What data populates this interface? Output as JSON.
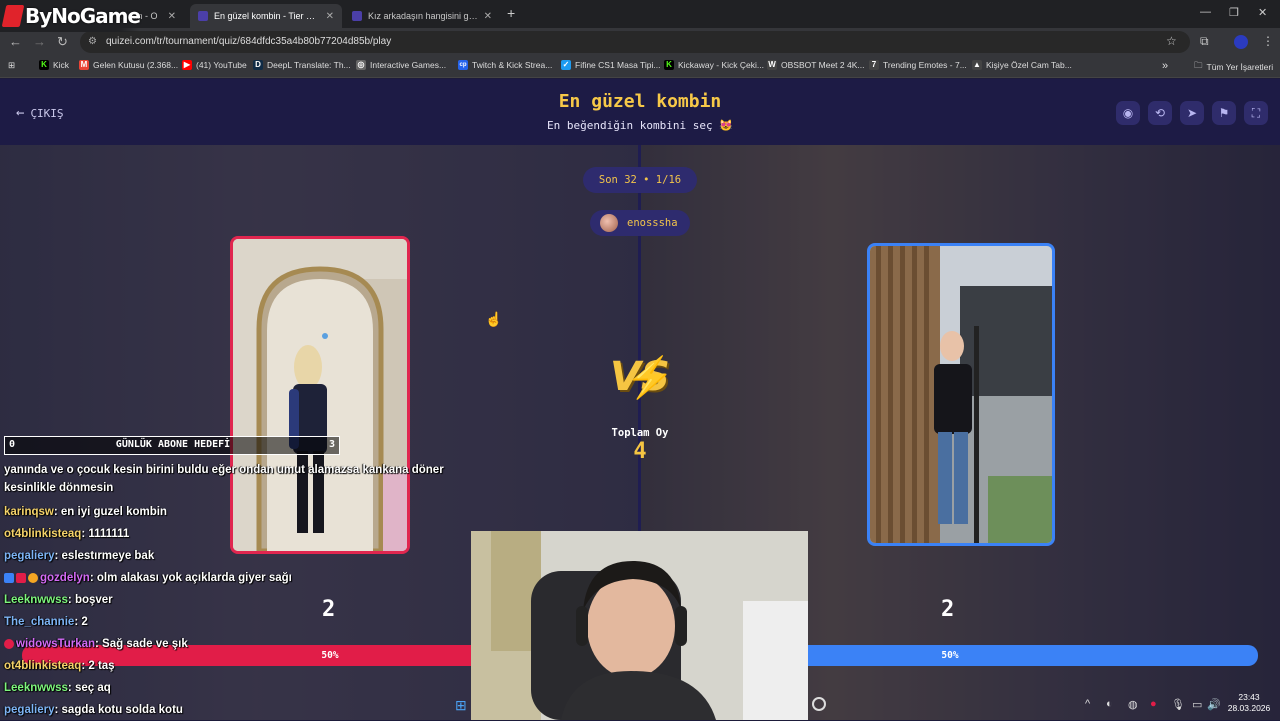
{
  "browser": {
    "tabs": [
      {
        "title": "...dan - O",
        "active": false,
        "color": "#5865f2"
      },
      {
        "title": "En güzel kombin - Tier List, Kör",
        "active": true,
        "color": "#4b3fa8"
      },
      {
        "title": "Kız arkadaşın hangisini giyebilir",
        "active": false,
        "color": "#4b3fa8"
      }
    ],
    "logo_text": "ByNoGame",
    "url": "quizei.com/tr/tournament/quiz/684dfdc35a4b80b77204d85b/play",
    "bookmarks": [
      {
        "label": "Kick",
        "color": "#53fc18",
        "glyph": "K"
      },
      {
        "label": "Gelen Kutusu (2.368...",
        "color": "#ea4335",
        "glyph": "M"
      },
      {
        "label": "(41) YouTube",
        "color": "#ff0000",
        "glyph": "▶"
      },
      {
        "label": "DeepL Translate: Th...",
        "color": "#0f2b46",
        "glyph": "D"
      },
      {
        "label": "Interactive Games...",
        "color": "#666",
        "glyph": "◎"
      },
      {
        "label": "Twitch & Kick Strea...",
        "color": "#2563eb",
        "glyph": "cp"
      },
      {
        "label": "Fifine CS1 Masa Tipi...",
        "color": "#1d9bf0",
        "glyph": "✓"
      },
      {
        "label": "Kickaway - Kick Çeki...",
        "color": "#53fc18",
        "glyph": "K"
      },
      {
        "label": "OBSBOT Meet 2 4K...",
        "color": "#444",
        "glyph": "W"
      },
      {
        "label": "Trending Emotes - 7...",
        "color": "#444",
        "glyph": "7"
      },
      {
        "label": "Kişiye Özel Cam Tab...",
        "color": "#444",
        "glyph": "▲"
      }
    ],
    "all_bookmarks": "Tüm Yer İşaretleri"
  },
  "quiz": {
    "back_label": "ÇIKIŞ",
    "title": "En güzel kombin",
    "subtitle": "En beğendiğin kombini seç 😻",
    "round": "Son 32 • 1/16",
    "username": "enosssha",
    "vs_text": "VS",
    "total_label": "Toplam Oy",
    "total_votes": "4",
    "left": {
      "votes": "2",
      "percent_label": "50%",
      "percent": 50,
      "accent": "#e11d48"
    },
    "right": {
      "votes": "2",
      "percent_label": "50%",
      "percent": 50,
      "accent": "#3b82f6"
    },
    "header_icons": [
      "eye-icon",
      "share-icon",
      "send-icon",
      "flag-icon",
      "fullscreen-icon"
    ]
  },
  "stream": {
    "sub_goal": {
      "current": "0",
      "label": "GÜNLÜK ABONE HEDEFİ",
      "target": "3"
    },
    "chat": [
      {
        "user": "",
        "color": "#fff",
        "text": "yanında ve o çocuk kesin birini buldu eğer ondan umut alamazsa kankana döner kesinlikle dönmesin"
      },
      {
        "user": "karinqsw",
        "color": "#f5d36a",
        "text": " : en iyi guzel kombin"
      },
      {
        "user": "ot4blinkisteaq",
        "color": "#f5d36a",
        "text": " : 1111111"
      },
      {
        "user": "pegaliery",
        "color": "#7db4f5",
        "text": " : eslestırmeye bak"
      },
      {
        "user": "gozdelyn",
        "color": "#d36af5",
        "text": " : olm alakası yok açıklarda giyer sağı",
        "badges": true
      },
      {
        "user": "Leeknwwss",
        "color": "#7df57d",
        "text": " : boşver"
      },
      {
        "user": "The_channie",
        "color": "#7db4f5",
        "text": " : 2"
      },
      {
        "user": "widowsTurkan",
        "color": "#d36af5",
        "text": " : Sağ sade ve şık",
        "badges": true
      },
      {
        "user": "ot4blinkisteaq",
        "color": "#f5d36a",
        "text": " : 2 taş"
      },
      {
        "user": "Leeknwwss",
        "color": "#7df57d",
        "text": " : seç aq"
      },
      {
        "user": "pegaliery",
        "color": "#7db4f5",
        "text": " : sagda kotu solda kotu"
      }
    ]
  },
  "taskbar": {
    "time": "23:43",
    "date": "28.03.2026"
  }
}
